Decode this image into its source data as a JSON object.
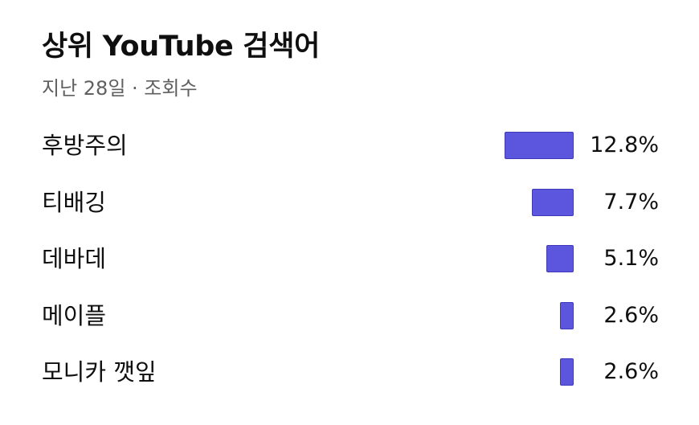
{
  "card": {
    "title": "상위 YouTube 검색어",
    "subtitle": "지난 28일 · 조회수"
  },
  "colors": {
    "bar_fill": "#5c55de",
    "title_text": "#0f0f0f",
    "subtitle_text": "#606060"
  },
  "terms": [
    {
      "label": "후방주의",
      "value_text": "12.8%",
      "share": 12.8
    },
    {
      "label": "티배깅",
      "value_text": "7.7%",
      "share": 7.7
    },
    {
      "label": "데바데",
      "value_text": "5.1%",
      "share": 5.1
    },
    {
      "label": "메이플",
      "value_text": "2.6%",
      "share": 2.6
    },
    {
      "label": "모니카 깻잎",
      "value_text": "2.6%",
      "share": 2.6
    }
  ]
}
